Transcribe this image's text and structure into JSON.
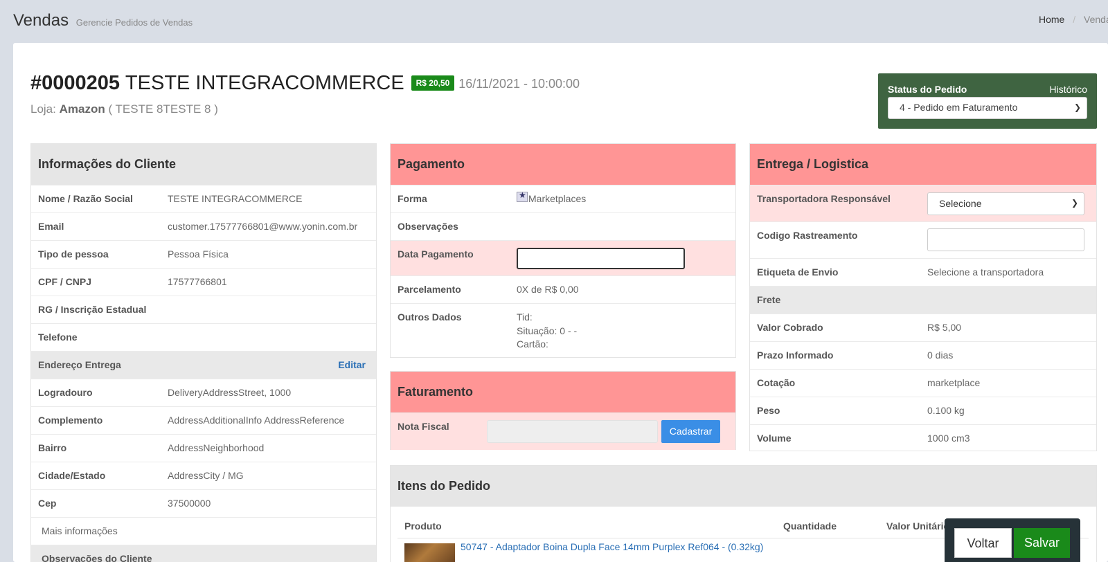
{
  "header": {
    "title": "Vendas",
    "subtitle": "Gerencie Pedidos de Vendas",
    "breadcrumb_home": "Home",
    "breadcrumb_sep": "/",
    "breadcrumb_current": "Venda"
  },
  "order": {
    "number": "#0000205",
    "name": "TESTE INTEGRACOMMERCE",
    "total": "R$ 20,50",
    "date": "16/11/2021 - 10:00:00",
    "store_prefix": "Loja:",
    "store_name": "Amazon",
    "store_detail": "( TESTE 8TESTE 8 )"
  },
  "status": {
    "label": "Status do Pedido",
    "history": "Histórico",
    "selected": "4 - Pedido em Faturamento"
  },
  "client": {
    "title": "Informações do Cliente",
    "rows": [
      {
        "label": "Nome / Razão Social",
        "value": "TESTE INTEGRACOMMERCE"
      },
      {
        "label": "Email",
        "value": "customer.17577766801@www.yonin.com.br"
      },
      {
        "label": "Tipo de pessoa",
        "value": "Pessoa Física"
      },
      {
        "label": "CPF / CNPJ",
        "value": "17577766801"
      },
      {
        "label": "RG / Inscrição Estadual",
        "value": ""
      },
      {
        "label": "Telefone",
        "value": ""
      }
    ],
    "address_header": "Endereço Entrega",
    "edit_label": "Editar",
    "address_rows": [
      {
        "label": "Logradouro",
        "value": "DeliveryAddressStreet, 1000"
      },
      {
        "label": "Complemento",
        "value": "AddressAdditionalInfo AddressReference"
      },
      {
        "label": "Bairro",
        "value": "AddressNeighborhood"
      },
      {
        "label": "Cidade/Estado",
        "value": "AddressCity / MG"
      },
      {
        "label": "Cep",
        "value": "37500000"
      }
    ],
    "more_info": "Mais informações",
    "notes_header": "Observações do Cliente"
  },
  "payment": {
    "title": "Pagamento",
    "forma_label": "Forma",
    "forma_value": "Marketplaces",
    "obs_label": "Observações",
    "date_label": "Data Pagamento",
    "date_value": "",
    "parcel_label": "Parcelamento",
    "parcel_value": "0X de R$ 0,00",
    "other_label": "Outros Dados",
    "other_lines": [
      "Tid:",
      "Situação: 0 - -",
      "Cartão:"
    ]
  },
  "billing": {
    "title": "Faturamento",
    "nf_label": "Nota Fiscal",
    "nf_value": "",
    "register_label": "Cadastrar"
  },
  "delivery": {
    "title": "Entrega / Logistica",
    "carrier_label": "Transportadora Responsável",
    "carrier_selected": "Selecione",
    "tracking_label": "Codigo Rastreamento",
    "tracking_value": "",
    "label_label": "Etiqueta de Envio",
    "label_value": "Selecione a transportadora",
    "freight_header": "Frete",
    "rows": [
      {
        "label": "Valor Cobrado",
        "value": "R$ 5,00"
      },
      {
        "label": "Prazo Informado",
        "value": "0 dias"
      },
      {
        "label": "Cotação",
        "value": "marketplace"
      },
      {
        "label": "Peso",
        "value": "0.100 kg"
      },
      {
        "label": "Volume",
        "value": "1000 cm3"
      }
    ]
  },
  "items": {
    "title": "Itens do Pedido",
    "col_product": "Produto",
    "col_qty": "Quantidade",
    "col_unit": "Valor Unitário",
    "first_item": "50747 - Adaptador Boina Dupla Face 14mm Purplex Ref064 - (0.32kg)"
  },
  "actions": {
    "back": "Voltar",
    "save": "Salvar"
  },
  "colors": {
    "accent_green": "#1a8a1a",
    "status_bg": "#3f6441",
    "panel_red": "#ff9595",
    "row_pink": "#ffe0e0",
    "link_blue": "#2a6fb5",
    "button_blue": "#3a8ee6"
  }
}
